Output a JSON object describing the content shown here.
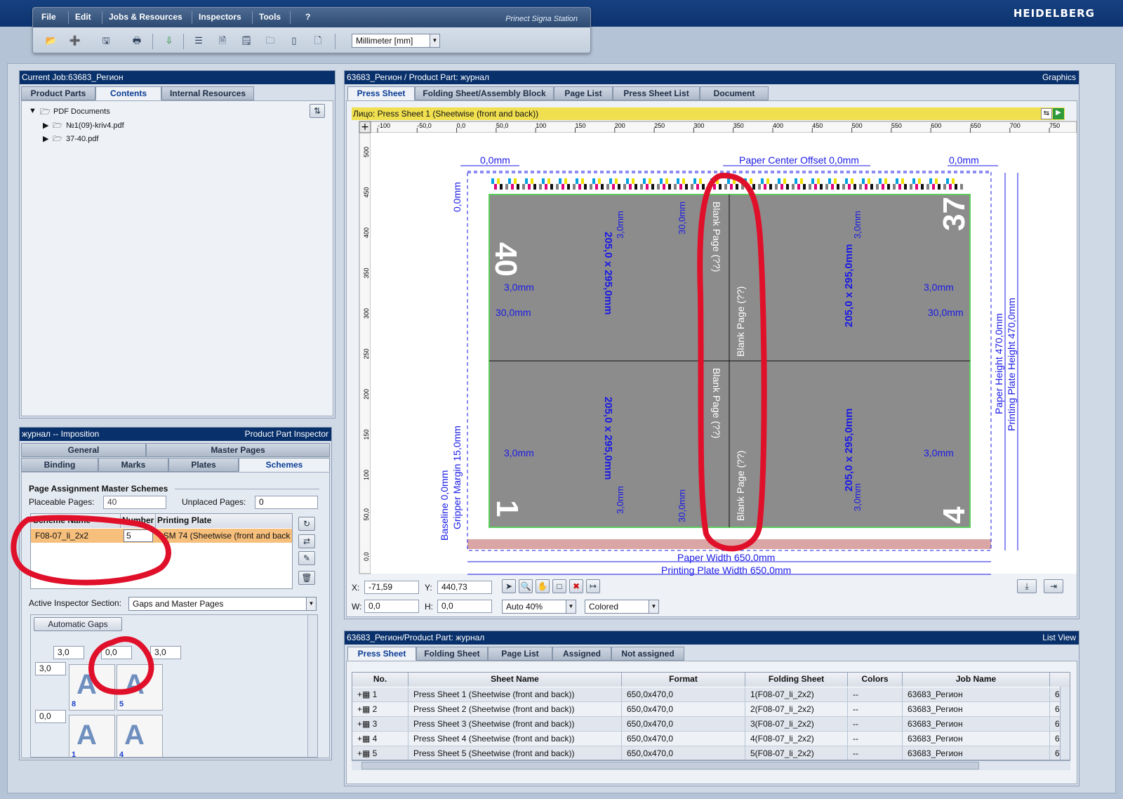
{
  "app": {
    "brand": "HEIDELBERG",
    "title": "Prinect Signa Station"
  },
  "menu": [
    "File",
    "Edit",
    "Jobs & Resources",
    "Inspectors",
    "Tools",
    "?"
  ],
  "toolbar": {
    "unit": "Millimeter  [mm]"
  },
  "job_panel": {
    "title": "Current Job:63683_Регион",
    "tabs": [
      "Product Parts",
      "Contents",
      "Internal Resources"
    ],
    "active_tab": "Contents",
    "tree": {
      "root": "PDF Documents",
      "children": [
        "№1(09)-kriv4.pdf",
        "37-40.pdf"
      ]
    }
  },
  "inspector": {
    "title": "журнал -- Imposition",
    "title_right": "Product Part Inspector",
    "tabs_row1": [
      "General",
      "Master Pages"
    ],
    "tabs_row2": [
      "Binding",
      "Marks",
      "Plates",
      "Schemes"
    ],
    "active_tab": "Schemes",
    "section_label": "Page Assignment  Master Schemes",
    "placeable_label": "Placeable Pages:",
    "placeable_value": "40",
    "unplaced_label": "Unplaced Pages:",
    "unplaced_value": "0",
    "scheme_cols": [
      "Scheme Name",
      "Number",
      "Printing Plate"
    ],
    "scheme_row": {
      "name": "F08-07_li_2x2",
      "number": "5",
      "plate": ": SM 74 (Sheetwise (front and back"
    },
    "active_section_label": "Active Inspector Section:",
    "active_section_value": "Gaps and Master Pages",
    "auto_gaps": "Automatic Gaps",
    "gaps": {
      "left": "3,0",
      "center": "0,0",
      "right": "3,0",
      "row1": "3,0",
      "row2": "0,0"
    },
    "thumb_nums": [
      "8",
      "5",
      "1",
      "4"
    ]
  },
  "graphics": {
    "title": "63683_Регион / Product Part: журнал",
    "title_right": "Graphics",
    "tabs": [
      "Press Sheet",
      "Folding Sheet/Assembly Block",
      "Page List",
      "Press Sheet List",
      "Document"
    ],
    "active_tab": "Press Sheet",
    "sheet_label": "Лицо:  Press Sheet 1 (Sheetwise (front and back))",
    "ruler_ticks": [
      "-100",
      "-50,0",
      "0,0",
      "50,0",
      "100",
      "150",
      "200",
      "250",
      "300",
      "350",
      "400",
      "450",
      "500",
      "550",
      "600",
      "650",
      "700",
      "750"
    ],
    "vruler_ticks": [
      "500",
      "450",
      "400",
      "350",
      "300",
      "250",
      "200",
      "150",
      "100",
      "50,0",
      "0,0"
    ],
    "dims": {
      "top_left": "0,0mm",
      "center_offset": "Paper Center Offset 0,0mm",
      "top_right": "0,0mm",
      "left_v": "0,0mm",
      "gap3": "3,0mm",
      "gap30": "30,0mm",
      "vgap3": "3,0mm",
      "vgap30": "30,0mm",
      "page_size": "205,0 x 295,0mm",
      "blank": "Blank Page (??)",
      "paper_width": "Paper Width 650,0mm",
      "plate_width": "Printing Plate Width 650,0mm",
      "paper_height": "Paper Height 470,0mm",
      "plate_height": "Printing Plate Height 470,0mm",
      "baseline": "Baseline 0,0mm",
      "gripper": "Gripper Margin 15,0mm"
    },
    "page_numbers": [
      "40",
      "37",
      "1",
      "4"
    ],
    "coords": {
      "x_label": "X:",
      "x": "-71,59",
      "y_label": "Y:",
      "y": "440,73",
      "w_label": "W:",
      "w": "0,0",
      "h_label": "H:",
      "h": "0,0"
    },
    "zoom": "Auto 40%",
    "color_mode": "Colored"
  },
  "list_view": {
    "title": "63683_Регион/Product Part: журнал",
    "title_right": "List View",
    "tabs": [
      "Press Sheet",
      "Folding Sheet",
      "Page List",
      "Assigned",
      "Not assigned"
    ],
    "active_tab": "Press Sheet",
    "columns": [
      "No.",
      "Sheet Name",
      "Format",
      "Folding Sheet",
      "Colors",
      "Job Name"
    ],
    "rows": [
      {
        "no": "1",
        "name": "Press Sheet 1 (Sheetwise (front and back))",
        "format": "650,0x470,0",
        "fold": "1(F08-07_li_2x2)",
        "colors": "--",
        "job": "63683_Регион",
        "extra": "6"
      },
      {
        "no": "2",
        "name": "Press Sheet 2 (Sheetwise (front and back))",
        "format": "650,0x470,0",
        "fold": "2(F08-07_li_2x2)",
        "colors": "--",
        "job": "63683_Регион",
        "extra": "6"
      },
      {
        "no": "3",
        "name": "Press Sheet 3 (Sheetwise (front and back))",
        "format": "650,0x470,0",
        "fold": "3(F08-07_li_2x2)",
        "colors": "--",
        "job": "63683_Регион",
        "extra": "6"
      },
      {
        "no": "4",
        "name": "Press Sheet 4 (Sheetwise (front and back))",
        "format": "650,0x470,0",
        "fold": "4(F08-07_li_2x2)",
        "colors": "--",
        "job": "63683_Регион",
        "extra": "6"
      },
      {
        "no": "5",
        "name": "Press Sheet 5 (Sheetwise (front and back))",
        "format": "650,0x470,0",
        "fold": "5(F08-07_li_2x2)",
        "colors": "--",
        "job": "63683_Регион",
        "extra": "6"
      }
    ]
  },
  "colors": {
    "annotation": "#e0102a",
    "dimension": "#1a1ae6",
    "page_fill": "#8c8c8c",
    "title_bar": "#08306b",
    "sheet_bar": "#f0e050"
  }
}
